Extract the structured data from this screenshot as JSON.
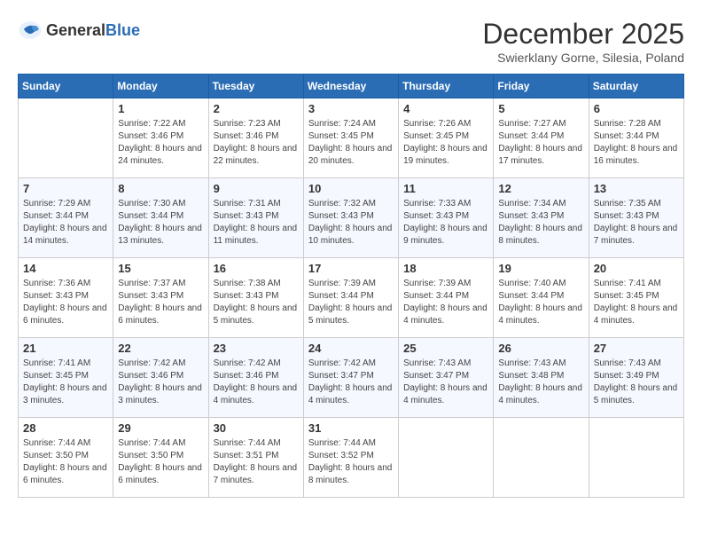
{
  "header": {
    "logo_general": "General",
    "logo_blue": "Blue",
    "month_title": "December 2025",
    "location": "Swierklany Gorne, Silesia, Poland"
  },
  "days_of_week": [
    "Sunday",
    "Monday",
    "Tuesday",
    "Wednesday",
    "Thursday",
    "Friday",
    "Saturday"
  ],
  "weeks": [
    [
      {
        "day": "",
        "sunrise": "",
        "sunset": "",
        "daylight": ""
      },
      {
        "day": "1",
        "sunrise": "Sunrise: 7:22 AM",
        "sunset": "Sunset: 3:46 PM",
        "daylight": "Daylight: 8 hours and 24 minutes."
      },
      {
        "day": "2",
        "sunrise": "Sunrise: 7:23 AM",
        "sunset": "Sunset: 3:46 PM",
        "daylight": "Daylight: 8 hours and 22 minutes."
      },
      {
        "day": "3",
        "sunrise": "Sunrise: 7:24 AM",
        "sunset": "Sunset: 3:45 PM",
        "daylight": "Daylight: 8 hours and 20 minutes."
      },
      {
        "day": "4",
        "sunrise": "Sunrise: 7:26 AM",
        "sunset": "Sunset: 3:45 PM",
        "daylight": "Daylight: 8 hours and 19 minutes."
      },
      {
        "day": "5",
        "sunrise": "Sunrise: 7:27 AM",
        "sunset": "Sunset: 3:44 PM",
        "daylight": "Daylight: 8 hours and 17 minutes."
      },
      {
        "day": "6",
        "sunrise": "Sunrise: 7:28 AM",
        "sunset": "Sunset: 3:44 PM",
        "daylight": "Daylight: 8 hours and 16 minutes."
      }
    ],
    [
      {
        "day": "7",
        "sunrise": "Sunrise: 7:29 AM",
        "sunset": "Sunset: 3:44 PM",
        "daylight": "Daylight: 8 hours and 14 minutes."
      },
      {
        "day": "8",
        "sunrise": "Sunrise: 7:30 AM",
        "sunset": "Sunset: 3:44 PM",
        "daylight": "Daylight: 8 hours and 13 minutes."
      },
      {
        "day": "9",
        "sunrise": "Sunrise: 7:31 AM",
        "sunset": "Sunset: 3:43 PM",
        "daylight": "Daylight: 8 hours and 11 minutes."
      },
      {
        "day": "10",
        "sunrise": "Sunrise: 7:32 AM",
        "sunset": "Sunset: 3:43 PM",
        "daylight": "Daylight: 8 hours and 10 minutes."
      },
      {
        "day": "11",
        "sunrise": "Sunrise: 7:33 AM",
        "sunset": "Sunset: 3:43 PM",
        "daylight": "Daylight: 8 hours and 9 minutes."
      },
      {
        "day": "12",
        "sunrise": "Sunrise: 7:34 AM",
        "sunset": "Sunset: 3:43 PM",
        "daylight": "Daylight: 8 hours and 8 minutes."
      },
      {
        "day": "13",
        "sunrise": "Sunrise: 7:35 AM",
        "sunset": "Sunset: 3:43 PM",
        "daylight": "Daylight: 8 hours and 7 minutes."
      }
    ],
    [
      {
        "day": "14",
        "sunrise": "Sunrise: 7:36 AM",
        "sunset": "Sunset: 3:43 PM",
        "daylight": "Daylight: 8 hours and 6 minutes."
      },
      {
        "day": "15",
        "sunrise": "Sunrise: 7:37 AM",
        "sunset": "Sunset: 3:43 PM",
        "daylight": "Daylight: 8 hours and 6 minutes."
      },
      {
        "day": "16",
        "sunrise": "Sunrise: 7:38 AM",
        "sunset": "Sunset: 3:43 PM",
        "daylight": "Daylight: 8 hours and 5 minutes."
      },
      {
        "day": "17",
        "sunrise": "Sunrise: 7:39 AM",
        "sunset": "Sunset: 3:44 PM",
        "daylight": "Daylight: 8 hours and 5 minutes."
      },
      {
        "day": "18",
        "sunrise": "Sunrise: 7:39 AM",
        "sunset": "Sunset: 3:44 PM",
        "daylight": "Daylight: 8 hours and 4 minutes."
      },
      {
        "day": "19",
        "sunrise": "Sunrise: 7:40 AM",
        "sunset": "Sunset: 3:44 PM",
        "daylight": "Daylight: 8 hours and 4 minutes."
      },
      {
        "day": "20",
        "sunrise": "Sunrise: 7:41 AM",
        "sunset": "Sunset: 3:45 PM",
        "daylight": "Daylight: 8 hours and 4 minutes."
      }
    ],
    [
      {
        "day": "21",
        "sunrise": "Sunrise: 7:41 AM",
        "sunset": "Sunset: 3:45 PM",
        "daylight": "Daylight: 8 hours and 3 minutes."
      },
      {
        "day": "22",
        "sunrise": "Sunrise: 7:42 AM",
        "sunset": "Sunset: 3:46 PM",
        "daylight": "Daylight: 8 hours and 3 minutes."
      },
      {
        "day": "23",
        "sunrise": "Sunrise: 7:42 AM",
        "sunset": "Sunset: 3:46 PM",
        "daylight": "Daylight: 8 hours and 4 minutes."
      },
      {
        "day": "24",
        "sunrise": "Sunrise: 7:42 AM",
        "sunset": "Sunset: 3:47 PM",
        "daylight": "Daylight: 8 hours and 4 minutes."
      },
      {
        "day": "25",
        "sunrise": "Sunrise: 7:43 AM",
        "sunset": "Sunset: 3:47 PM",
        "daylight": "Daylight: 8 hours and 4 minutes."
      },
      {
        "day": "26",
        "sunrise": "Sunrise: 7:43 AM",
        "sunset": "Sunset: 3:48 PM",
        "daylight": "Daylight: 8 hours and 4 minutes."
      },
      {
        "day": "27",
        "sunrise": "Sunrise: 7:43 AM",
        "sunset": "Sunset: 3:49 PM",
        "daylight": "Daylight: 8 hours and 5 minutes."
      }
    ],
    [
      {
        "day": "28",
        "sunrise": "Sunrise: 7:44 AM",
        "sunset": "Sunset: 3:50 PM",
        "daylight": "Daylight: 8 hours and 6 minutes."
      },
      {
        "day": "29",
        "sunrise": "Sunrise: 7:44 AM",
        "sunset": "Sunset: 3:50 PM",
        "daylight": "Daylight: 8 hours and 6 minutes."
      },
      {
        "day": "30",
        "sunrise": "Sunrise: 7:44 AM",
        "sunset": "Sunset: 3:51 PM",
        "daylight": "Daylight: 8 hours and 7 minutes."
      },
      {
        "day": "31",
        "sunrise": "Sunrise: 7:44 AM",
        "sunset": "Sunset: 3:52 PM",
        "daylight": "Daylight: 8 hours and 8 minutes."
      },
      {
        "day": "",
        "sunrise": "",
        "sunset": "",
        "daylight": ""
      },
      {
        "day": "",
        "sunrise": "",
        "sunset": "",
        "daylight": ""
      },
      {
        "day": "",
        "sunrise": "",
        "sunset": "",
        "daylight": ""
      }
    ]
  ]
}
